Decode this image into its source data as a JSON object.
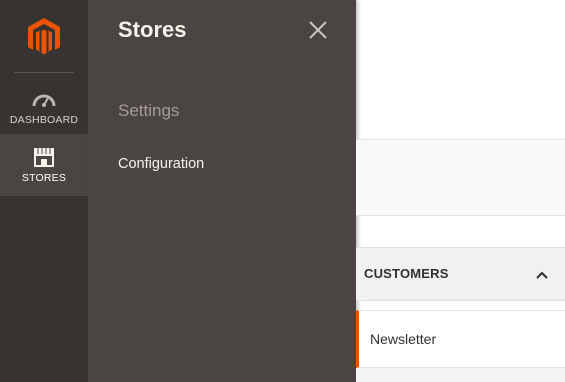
{
  "nav": {
    "logo_icon": "magento-logo-icon",
    "brand_color": "#eb5202",
    "items": [
      {
        "label": "DASHBOARD",
        "icon": "speedometer-icon"
      },
      {
        "label": "STORES",
        "icon": "storefront-icon",
        "active": true
      }
    ]
  },
  "panel": {
    "title": "Stores",
    "close_icon": "close-icon",
    "section_title": "Settings",
    "links": [
      {
        "label": "Configuration"
      }
    ]
  },
  "page": {
    "customers_section": {
      "label": "CUSTOMERS",
      "expanded": true,
      "toggle_icon": "chevron-up-icon"
    },
    "customers_items": [
      {
        "label": "Newsletter",
        "active": true
      }
    ]
  }
}
